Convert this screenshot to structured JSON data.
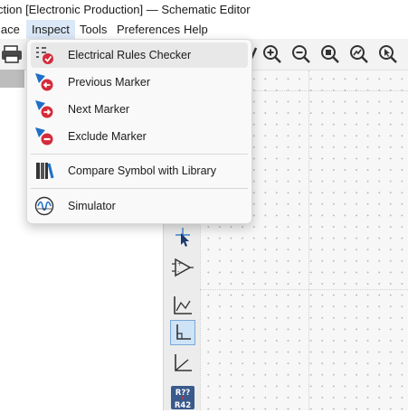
{
  "window": {
    "title": "ction [Electronic Production] — Schematic Editor"
  },
  "menubar": {
    "items": [
      {
        "label": "lace"
      },
      {
        "label": "Inspect",
        "active": true
      },
      {
        "label": "Tools"
      },
      {
        "label": "Preferences"
      },
      {
        "label": "Help"
      }
    ]
  },
  "toolbar": {
    "icons": [
      "print-icon",
      "zoom-in-icon",
      "zoom-out-icon",
      "zoom-fit-icon",
      "zoom-objects-icon",
      "zoom-selection-icon"
    ]
  },
  "inspect_menu": {
    "items": [
      {
        "label": "Electrical Rules Checker",
        "icon": "erc-icon",
        "hover": true
      },
      {
        "label": "Previous Marker",
        "icon": "previous-marker-icon"
      },
      {
        "label": "Next Marker",
        "icon": "next-marker-icon"
      },
      {
        "label": "Exclude Marker",
        "icon": "exclude-marker-icon"
      },
      {
        "label": "Compare Symbol with Library",
        "icon": "library-icon"
      },
      {
        "label": "Simulator",
        "icon": "simulator-icon"
      }
    ]
  },
  "right_toolbar": {
    "annotation_badge": {
      "top": "R??",
      "bottom": "R42"
    }
  },
  "colors": {
    "accent": "#1e6fc8",
    "erc_red": "#d52b3a",
    "menu_hover": "#e8e8e8",
    "selected_tool": "#cfe3f7"
  }
}
